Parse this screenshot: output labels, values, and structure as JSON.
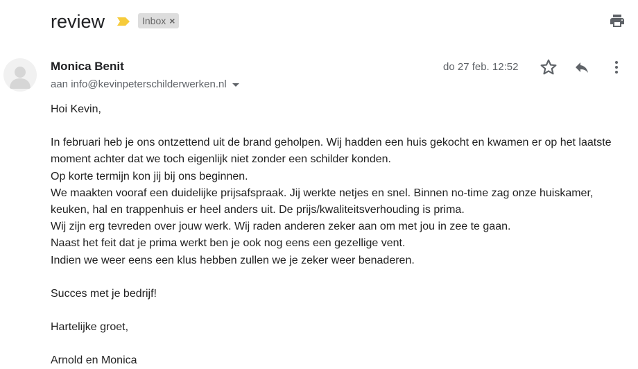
{
  "email": {
    "subject": "review",
    "label": "Inbox",
    "label_remove": "×",
    "sender_name": "Monica Benit",
    "recipient": "aan info@kevinpeterschilderwerken.nl",
    "date": "do 27 feb. 12:52",
    "body": {
      "greeting": "Hoi Kevin,",
      "lines": [
        "In februari heb je ons ontzettend uit de brand geholpen. Wij hadden een huis gekocht en kwamen er op het laatste",
        "moment achter dat we toch eigenlijk niet zonder een schilder konden.",
        "Op korte termijn kon jij bij ons beginnen.",
        "We maakten vooraf een duidelijke prijsafspraak.  Jij werkte netjes en snel. Binnen no-time zag onze huiskamer,",
        "keuken, hal en trappenhuis er heel anders uit. De prijs/kwaliteitsverhouding is prima.",
        "Wij zijn erg tevreden over jouw werk. Wij raden anderen zeker aan om met jou in zee te gaan.",
        "Naast het feit dat je prima werkt ben je ook nog eens een gezellige vent.",
        "Indien we weer eens een klus hebben zullen we je zeker weer benaderen."
      ],
      "closing_wish": "Succes met je bedrijf!",
      "sign_off": "Hartelijke groet,",
      "signature": "Arnold en Monica"
    }
  },
  "icons": {
    "importance": "importance-marker-icon",
    "print": "print-icon",
    "avatar": "avatar-icon",
    "star": "star-icon",
    "reply": "reply-icon",
    "more": "more-vertical-icon"
  },
  "colors": {
    "importance_marker": "#f6cb3b",
    "chip_bg": "#dddddd",
    "secondary_text": "#5f6368"
  }
}
